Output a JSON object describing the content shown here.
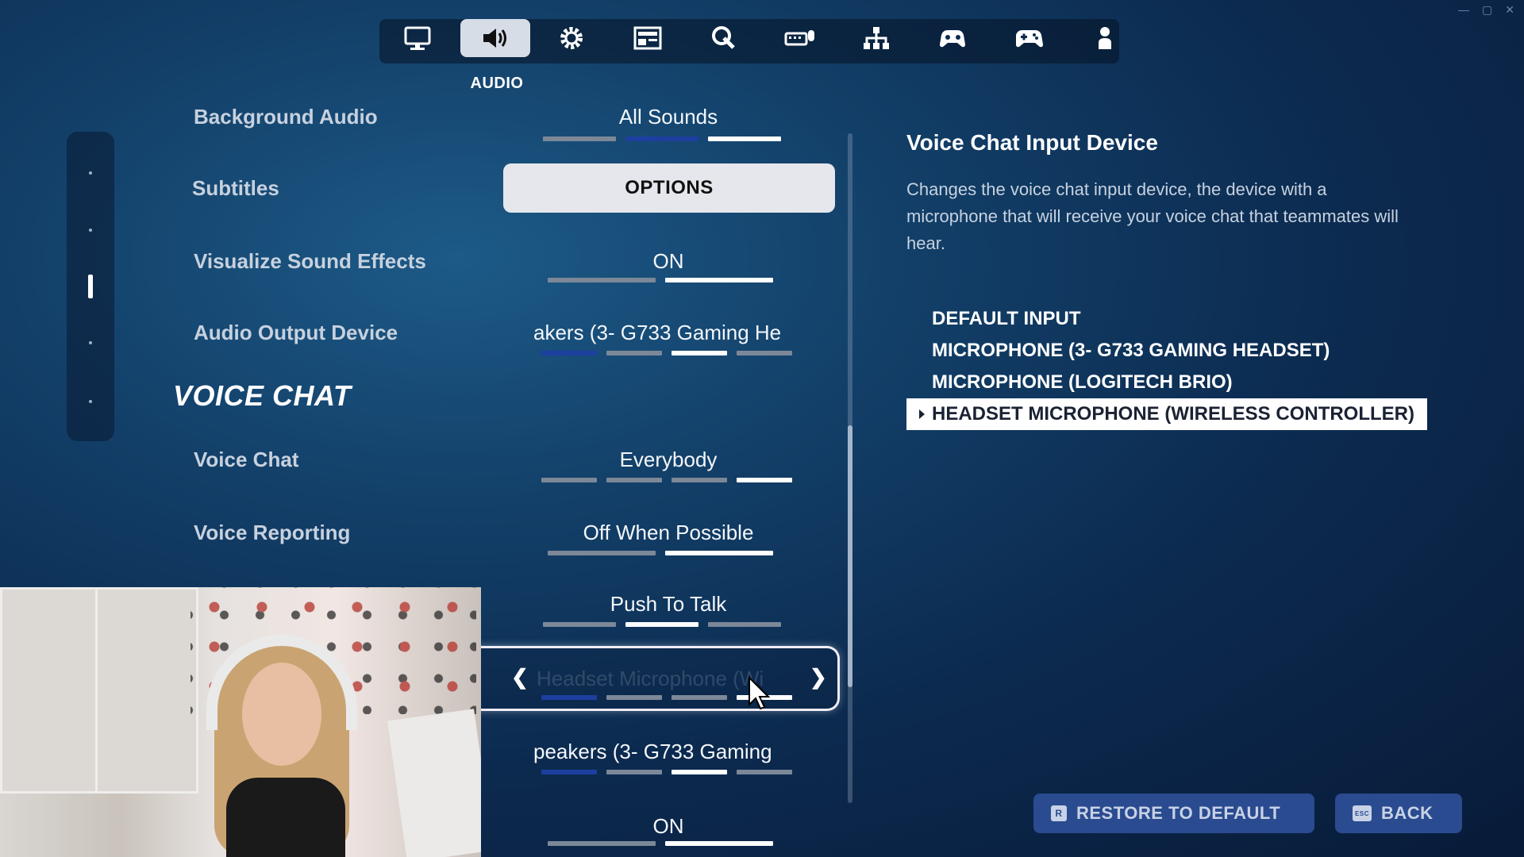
{
  "tabs": [
    {
      "id": "display",
      "icon": "monitor-icon",
      "active": false
    },
    {
      "id": "audio",
      "icon": "speaker-icon",
      "active": true,
      "label": "AUDIO"
    },
    {
      "id": "game",
      "icon": "gear-icon",
      "active": false
    },
    {
      "id": "ui",
      "icon": "layout-icon",
      "active": false
    },
    {
      "id": "touch",
      "icon": "touch-icon",
      "active": false
    },
    {
      "id": "keyboard",
      "icon": "keyboard-mouse-icon",
      "active": false
    },
    {
      "id": "controls",
      "icon": "network-icon",
      "active": false
    },
    {
      "id": "controller",
      "icon": "controller-settings-icon",
      "active": false
    },
    {
      "id": "gamepad",
      "icon": "gamepad-icon",
      "active": false
    },
    {
      "id": "account",
      "icon": "person-icon",
      "active": false
    }
  ],
  "active_tab_label": "AUDIO",
  "settings": {
    "background_audio": {
      "label": "Background Audio",
      "value": "All Sounds"
    },
    "subtitles": {
      "label": "Subtitles",
      "button": "OPTIONS"
    },
    "visualize_sound_effects": {
      "label": "Visualize Sound Effects",
      "value": "ON"
    },
    "audio_output_device": {
      "label": "Audio Output Device",
      "value": "akers (3- G733 Gaming He"
    },
    "section_title": "VOICE CHAT",
    "voice_chat": {
      "label": "Voice Chat",
      "value": "Everybody"
    },
    "voice_reporting": {
      "label": "Voice Reporting",
      "value": "Off When Possible"
    },
    "voice_chat_method": {
      "value": "Push To Talk"
    },
    "voice_chat_input_device": {
      "value": "Headset Microphone (Wi"
    },
    "voice_chat_output_device": {
      "value": "peakers (3- G733 Gaming"
    },
    "last_toggle": {
      "value": "ON"
    }
  },
  "panel": {
    "title": "Voice Chat Input Device",
    "description": "Changes the voice chat input device, the device with a microphone that will receive your voice chat that teammates will hear.",
    "devices": [
      {
        "label": "DEFAULT INPUT",
        "selected": false
      },
      {
        "label": "MICROPHONE (3- G733 GAMING HEADSET)",
        "selected": false
      },
      {
        "label": "MICROPHONE (LOGITECH BRIO)",
        "selected": false
      },
      {
        "label": "HEADSET MICROPHONE (WIRELESS CONTROLLER)",
        "selected": true
      }
    ]
  },
  "footer": {
    "restore_label": "RESTORE TO DEFAULT",
    "restore_key": "R",
    "back_label": "BACK",
    "back_key": "ESC"
  },
  "colors": {
    "accent_blue": "#1d3fa0",
    "selected_white": "#ffffff",
    "footer_button": "#2a4b8f"
  }
}
